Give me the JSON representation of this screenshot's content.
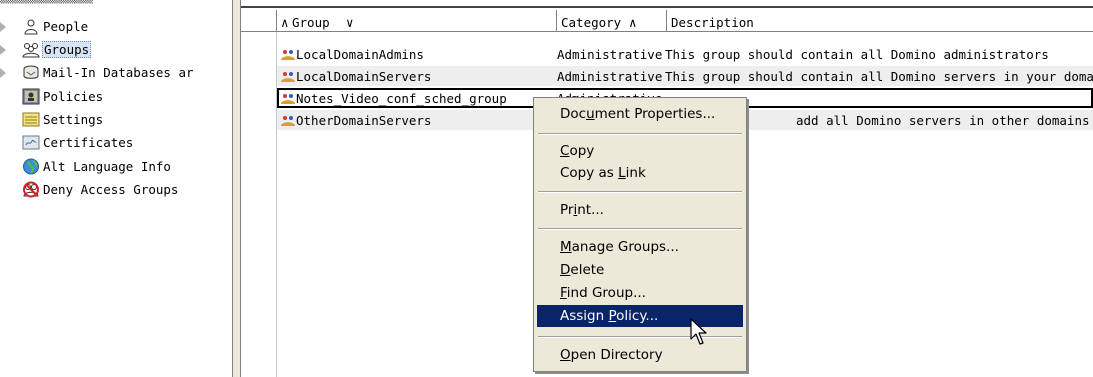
{
  "tree": {
    "items": [
      {
        "label": "People",
        "icon": "person-icon",
        "expandable": true
      },
      {
        "label": "Groups",
        "icon": "group-icon",
        "expandable": true,
        "selected": true
      },
      {
        "label": "Mail-In Databases ar",
        "icon": "mail-in-database-icon",
        "expandable": true
      },
      {
        "label": "Policies",
        "icon": "policy-icon",
        "expandable": false
      },
      {
        "label": "Settings",
        "icon": "settings-icon",
        "expandable": false
      },
      {
        "label": "Certificates",
        "icon": "certificate-icon",
        "expandable": false
      },
      {
        "label": "Alt Language Info",
        "icon": "globe-icon",
        "expandable": false
      },
      {
        "label": "Deny Access Groups",
        "icon": "deny-access-icon",
        "expandable": false
      }
    ]
  },
  "table": {
    "columns": [
      {
        "label": "Group",
        "sort": "ascending-descending"
      },
      {
        "label": "Category",
        "sort": "ascending"
      },
      {
        "label": "Description",
        "sort": "none"
      }
    ],
    "rows": [
      {
        "group": "LocalDomainAdmins",
        "category": "Administrative",
        "description": "This group should contain all Domino administrators"
      },
      {
        "group": "LocalDomainServers",
        "category": "Administrative",
        "description": "This group should contain all Domino servers in your domain"
      },
      {
        "group": "Notes_Video_conf_sched_group",
        "category": "Administrative",
        "description": ""
      },
      {
        "group": "OtherDomainServers",
        "category": "",
        "description": "add all Domino servers in other domains"
      }
    ]
  },
  "context_menu": {
    "items": [
      {
        "pre": "Doc",
        "ul": "u",
        "post": "ment Properties..."
      },
      {
        "pre": "",
        "ul": "C",
        "post": "opy"
      },
      {
        "pre": "Copy as ",
        "ul": "L",
        "post": "ink"
      },
      {
        "pre": "Pr",
        "ul": "i",
        "post": "nt..."
      },
      {
        "pre": "",
        "ul": "M",
        "post": "anage Groups..."
      },
      {
        "pre": "",
        "ul": "D",
        "post": "elete"
      },
      {
        "pre": "",
        "ul": "F",
        "post": "ind Group..."
      },
      {
        "pre": "Assign ",
        "ul": "P",
        "post": "olicy..."
      },
      {
        "pre": "",
        "ul": "O",
        "post": "pen Directory"
      }
    ],
    "highlight_color": "#0a246a"
  }
}
